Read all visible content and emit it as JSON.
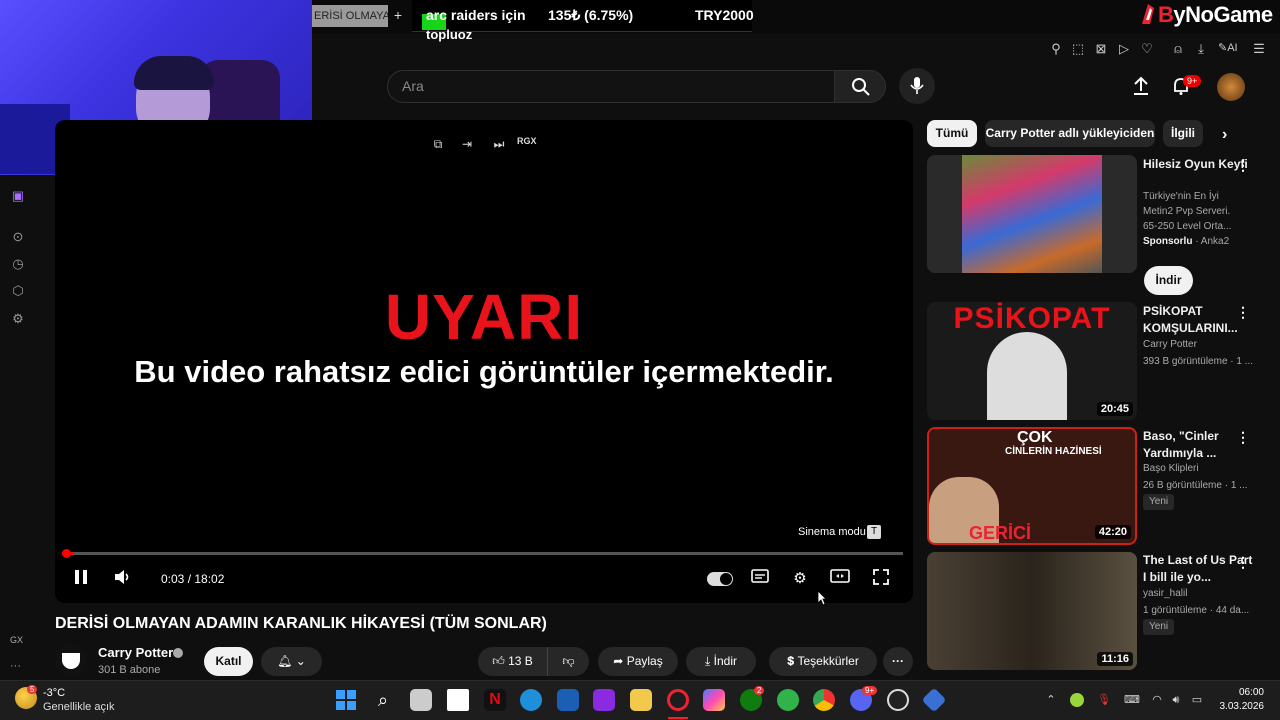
{
  "browser": {
    "tab_label": "ERİSİ OLMAYAN",
    "new_tab": "+",
    "ticker": {
      "item1": "arc raiders için",
      "item1b": "topluoz",
      "item2": "135₺ (6.75%)",
      "item3": "TRY2000"
    },
    "logo": {
      "b": "B",
      "rest": "yNoGame"
    },
    "ai_label": "AI",
    "sidebar_gx": "GX",
    "sidebar_more": "···"
  },
  "header": {
    "search_placeholder": "Ara",
    "notif_count": "9+"
  },
  "player": {
    "warning_title": "UYARI",
    "warning_text": "Bu video rahatsız edici görüntüler içermektedir.",
    "rgx": "RGX",
    "cinema_label": "Sinema modu",
    "cinema_key": "T",
    "time": "0:03 / 18:02",
    "progress": 0.0028
  },
  "video": {
    "title": "DERİSİ OLMAYAN ADAMIN KARANLIK HİKAYESİ (TÜM SONLAR)",
    "channel": "Carry Potter",
    "subs": "301 B abone",
    "join": "Katıl",
    "likes": "13 B",
    "share": "Paylaş",
    "download": "İndir",
    "thanks": "Teşekkürler"
  },
  "chips": [
    "Tümü",
    "Carry Potter adlı yükleyiciden",
    "İlgili"
  ],
  "recs": [
    {
      "title": "Hilesiz Oyun Keyfi",
      "desc1": "Türkiye'nin En İyi",
      "desc2": "Metin2 Pvp Serveri.",
      "desc3": "65-250 Level Orta...",
      "sponsor": "Sponsorlu",
      "sponsor_name": "· Anka2",
      "cta": "İndir"
    },
    {
      "title": "PSİKOPAT KOMŞULARINI...",
      "channel": "Carry Potter",
      "meta": "393 B görüntüleme · 1 ...",
      "duration": "20:45",
      "thumb_text": "PSİKOPAT"
    },
    {
      "title": "Baso, \"Cinler Yardımıyla ...",
      "channel": "Başo Klipleri",
      "meta": "26 B görüntüleme · 1 ...",
      "badge": "Yeni",
      "duration": "42:20",
      "thumb_text1": "ÇOK",
      "thumb_text2": "CİNLERİN HAZİNESİ",
      "thumb_text3": "GERİCİ"
    },
    {
      "title": "The Last of Us Part I bill ile yo...",
      "channel": "yasir_halil",
      "meta": "1 görüntüleme · 44 da...",
      "badge": "Yeni",
      "duration": "11:16"
    }
  ],
  "taskbar": {
    "weather_temp": "-3°C",
    "weather_desc": "Genellikle açık",
    "weather_badge": "5",
    "time": "06:00",
    "date": "3.03.2026",
    "xbox_badge": "2",
    "discord_badge": "9+"
  }
}
